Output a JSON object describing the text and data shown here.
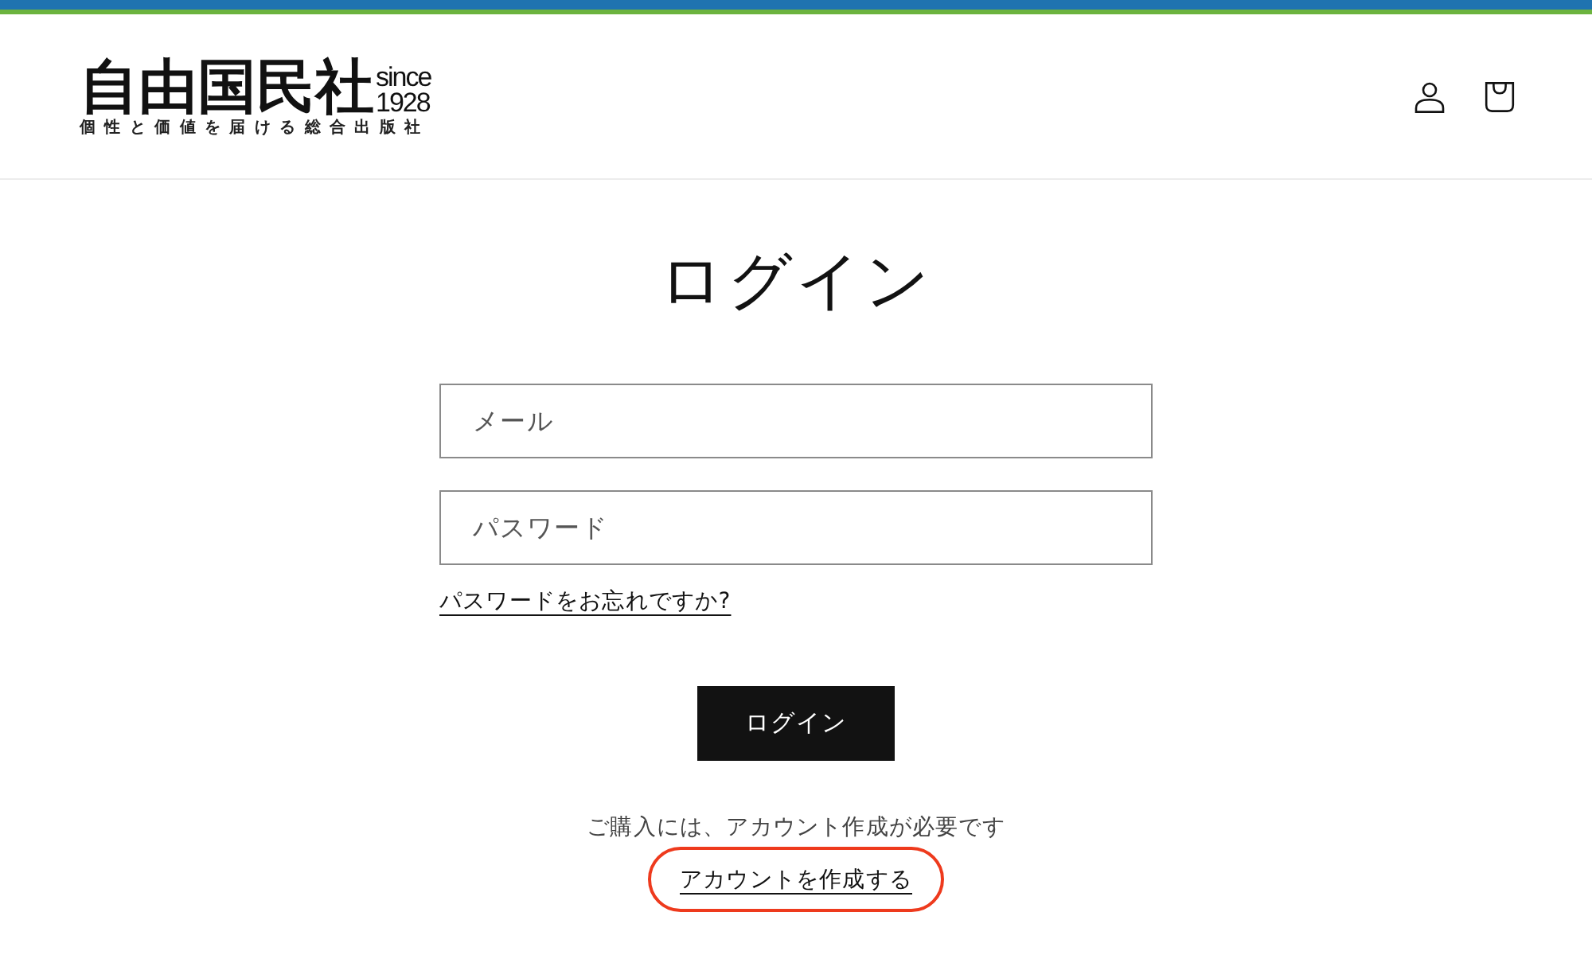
{
  "header": {
    "logo": {
      "name": "自由国民社",
      "since": "since",
      "year": "1928",
      "tagline": "個性と価値を届ける総合出版社"
    }
  },
  "title": "ログイン",
  "email_field": {
    "placeholder": "メール"
  },
  "password_field": {
    "placeholder": "パスワード"
  },
  "forgot_link": "パスワードをお忘れですか?",
  "submit_button": "ログイン",
  "note": "ご購入には、アカウント作成が必要です",
  "create_account_link": {
    "label": "アカウントを作成する",
    "highlighted": true
  }
}
